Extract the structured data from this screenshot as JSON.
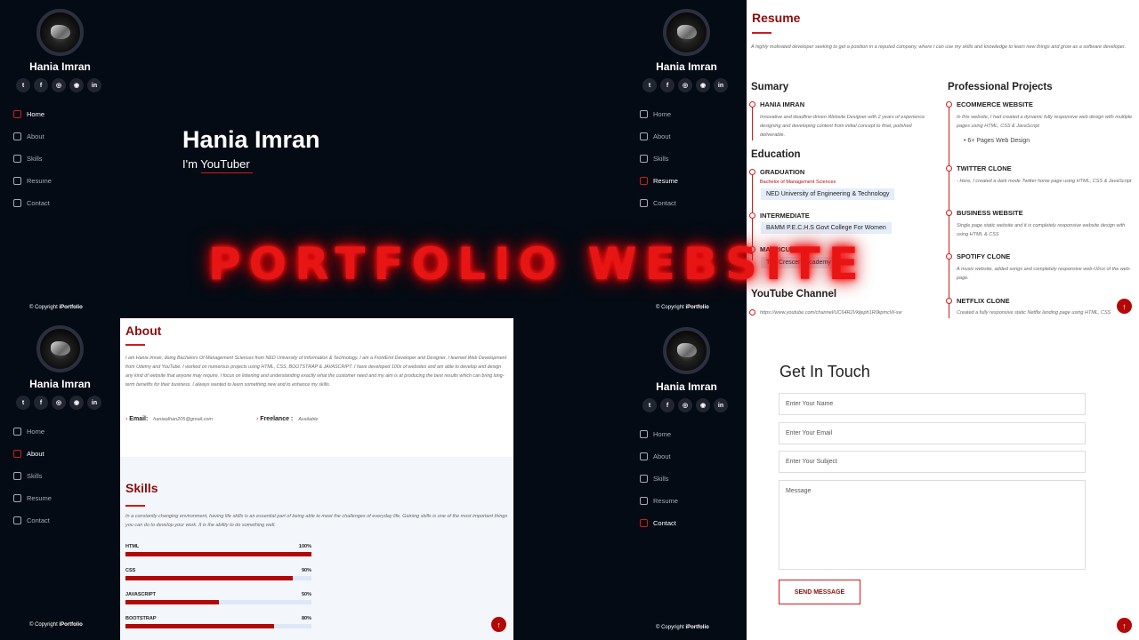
{
  "profile": {
    "name": "Hania Imran",
    "socials": [
      "twitter-icon",
      "facebook-icon",
      "instagram-icon",
      "github-icon",
      "linkedin-icon"
    ],
    "social_glyphs": [
      "t",
      "f",
      "◎",
      "◉",
      "in"
    ]
  },
  "nav": {
    "home": "Home",
    "about": "About",
    "skills": "Skills",
    "resume": "Resume",
    "contact": "Contact"
  },
  "copyright": {
    "prefix": "© Copyright",
    "brand": "iPortfolio"
  },
  "hero": {
    "title": "Hania Imran",
    "subtitle": "I'm YouTuber"
  },
  "overlay": {
    "title": "PORTFOLIO WEBSITE"
  },
  "resume": {
    "title": "Resume",
    "intro": "A highly motivated developer seeking to get a position in a reputed company, where I can use my skills and knowledge to learn new things and grow as a software developer.",
    "summary_heading": "Sumary",
    "summary_name": "HANIA IMRAN",
    "summary_text": "Innovative and deadline-driven Website Designer with 2 years of experience designing and developing content from initial concept to final, polished deliverable.",
    "education_heading": "Education",
    "graduation": "GRADUATION",
    "graduation_degree": "Bachelor of Management Sciences",
    "graduation_school": "NED University of Engineering & Technology",
    "intermediate": "INTERMEDIATE",
    "intermediate_school": "BAMM P.E.C.H.S Govt College For Women",
    "matriculation": "MATRICULATION",
    "matriculation_school": "The Crescent Academy",
    "youtube_heading": "YouTube Channel",
    "youtube_url": "https://www.youtube.com/channel/UC64R2Vkljeph1R0kpmcW-sw",
    "projects_heading": "Professional Projects",
    "projects": [
      {
        "title": "ECOMMERCE WEBSITE",
        "desc": "In this website, I had created a dynamic fully responsive web design with multiple pages using HTML, CSS & JavaScript",
        "bullet": "6+ Pages Web Design"
      },
      {
        "title": "TWITTER CLONE",
        "desc": "- Here, I created a dark mode Twitter home page using HTML, CSS & JavaScript"
      },
      {
        "title": "BUSINESS WEBSITE",
        "desc": "Single page static website and it is completely responsive website design with using HTML & CSS"
      },
      {
        "title": "SPOTIFY CLONE",
        "desc": "A music website, added songs and completely responsive web-UI/ux of the web-page."
      },
      {
        "title": "NETFLIX CLONE",
        "desc": "Created a fully responsive static Netflix landing page using HTML, CSS"
      }
    ]
  },
  "about": {
    "title": "About",
    "text": "I am Hania Imran, doing Bachelors Of Management Sciences from NED University of Information & Technology. I am a FrontEnd Developer and Designer. I learned Web Development from Udemy and YouTube. I worked on numerous projects using HTML, CSS, BOOTSTRAP & JAVASCRIPT. I have developed 100s of websites and am able to develop and design any kind of website that anyone may require. I focus on listening and understanding exactly what the customer need and my aim is at producing the best results which can bring long-term benefits for their business. I always wanted to learn something new and to enhance my skills.",
    "email_label": "Email:",
    "email_value": "haniaalhan205@gmail.com",
    "freelance_label": "Freelance :",
    "freelance_value": "Available"
  },
  "skills": {
    "title": "Skills",
    "text": "In a constantly changing environment, having life skills is an essential part of being able to meet the challenges of everyday life. Gaining skills is one of the most important things you can do to develop your work. It is the ability to do something well.",
    "items": [
      {
        "name": "HTML",
        "label": "100%",
        "value": 100
      },
      {
        "name": "CSS",
        "label": "90%",
        "value": 90
      },
      {
        "name": "JAVASCRIPT",
        "label": "50%",
        "value": 50
      },
      {
        "name": "BOOTSTRAP",
        "label": "80%",
        "value": 80
      }
    ]
  },
  "contact": {
    "title": "Get In Touch",
    "name_placeholder": "Enter Your Name",
    "email_placeholder": "Enter Your Email",
    "subject_placeholder": "Enter Your Subject",
    "message_placeholder": "Message",
    "send_label": "SEND MESSAGE"
  },
  "colors": {
    "accent": "#cf1c1c",
    "dark_bg": "#040b14",
    "heading": "#8b0e0e"
  }
}
